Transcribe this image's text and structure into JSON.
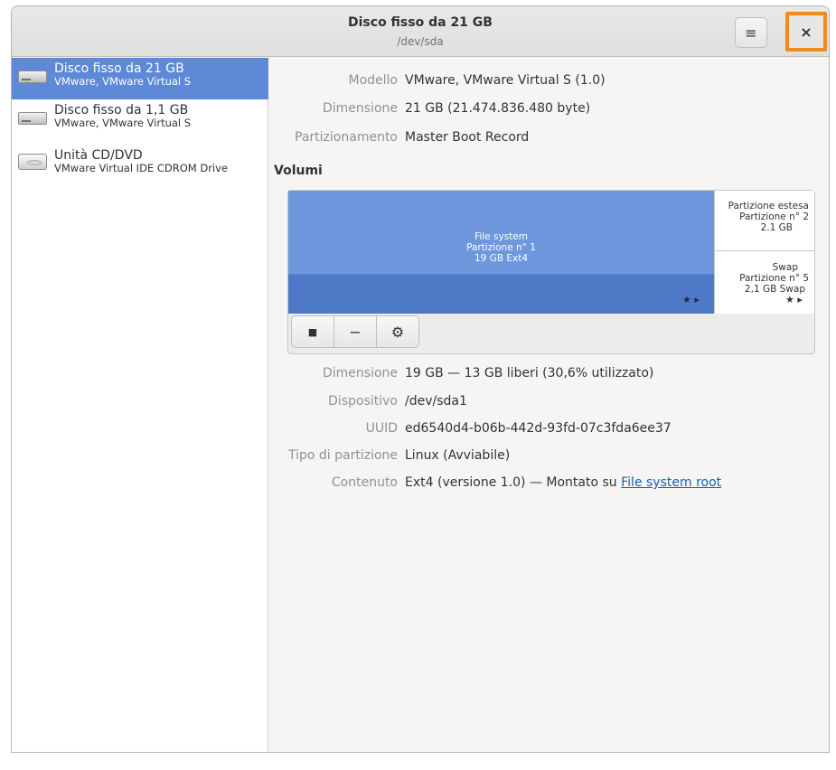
{
  "header": {
    "title": "Disco fisso da 21 GB",
    "subtitle": "/dev/sda",
    "menu_icon": "≡",
    "close_icon": "×"
  },
  "sidebar": {
    "items": [
      {
        "name": "Disco fisso da 21 GB",
        "sub": "VMware, VMware Virtual S",
        "icon": "hdd-icon"
      },
      {
        "name": "Disco fisso da 1,1 GB",
        "sub": "VMware, VMware Virtual S",
        "icon": "hdd-icon"
      },
      {
        "name": "Unità CD/DVD",
        "sub": "VMware Virtual IDE CDROM Drive",
        "icon": "cd-drive-icon"
      }
    ]
  },
  "disk_props": {
    "model_label": "Modello",
    "model_value": "VMware, VMware Virtual S (1.0)",
    "size_label": "Dimensione",
    "size_value": "21 GB (21.474.836.480 byte)",
    "partitioning_label": "Partizionamento",
    "partitioning_value": "Master Boot Record"
  },
  "volumes": {
    "title": "Volumi",
    "main_partition": {
      "line1": "File system",
      "line2": "Partizione n° 1",
      "line3": "19 GB Ext4"
    },
    "extended_partition": {
      "line1": "Partizione estesa",
      "line2": "Partizione n° 2",
      "line3": "2.1 GB"
    },
    "swap_partition": {
      "line1": "Swap",
      "line2": "Partizione n° 5",
      "line3": "2,1 GB Swap"
    },
    "toolbar": {
      "stop_icon": "■",
      "remove_icon": "−",
      "settings_icon": "⚙"
    }
  },
  "volume_props": {
    "size_label": "Dimensione",
    "size_value": "19 GB — 13 GB liberi (30,6% utilizzato)",
    "device_label": "Dispositivo",
    "device_value": "/dev/sda1",
    "uuid_label": "UUID",
    "uuid_value": "ed6540d4-b06b-442d-93fd-07c3fda6ee37",
    "type_label": "Tipo di partizione",
    "type_value": "Linux (Avviabile)",
    "content_label": "Contenuto",
    "content_value": "Ext4 (versione 1.0) — Montato su ",
    "content_link": "File system root"
  }
}
